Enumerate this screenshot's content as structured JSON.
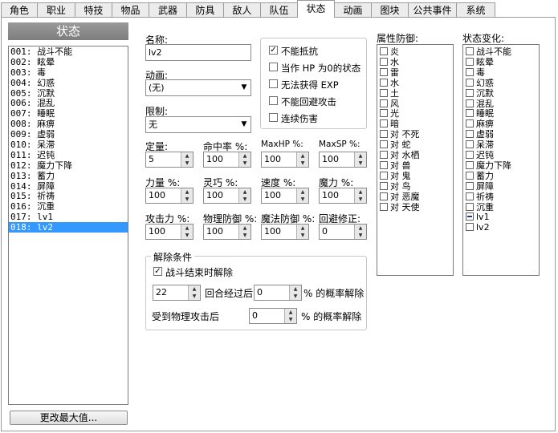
{
  "tabs": [
    "角色",
    "职业",
    "特技",
    "物品",
    "武器",
    "防具",
    "敌人",
    "队伍",
    "状态",
    "动画",
    "图块",
    "公共事件",
    "系统"
  ],
  "active_tab": "状态",
  "list_title": "状态",
  "states": [
    "001: 战斗不能",
    "002: 眩晕",
    "003: 毒",
    "004: 幻惑",
    "005: 沉默",
    "006: 混乱",
    "007: 睡眠",
    "008: 麻痹",
    "009: 虚弱",
    "010: 呆滞",
    "011: 迟钝",
    "012: 魔力下降",
    "013: 蓄力",
    "014: 屏障",
    "015: 祈祷",
    "016: 沉重",
    "017: lv1",
    "018: lv2"
  ],
  "selected_index": 17,
  "change_max_button": "更改最大值...",
  "form": {
    "name_label": "名称:",
    "name_value": "lv2",
    "animation_label": "动画:",
    "animation_value": "(无)",
    "restriction_label": "限制:",
    "restriction_value": "无",
    "fields": [
      {
        "label": "定量:",
        "value": "5"
      },
      {
        "label": "命中率 %:",
        "value": "100"
      },
      {
        "label": "MaxHP %:",
        "value": "100"
      },
      {
        "label": "MaxSP %:",
        "value": "100"
      },
      {
        "label": "力量 %:",
        "value": "100"
      },
      {
        "label": "灵巧 %:",
        "value": "100"
      },
      {
        "label": "速度 %:",
        "value": "100"
      },
      {
        "label": "魔力 %:",
        "value": "100"
      },
      {
        "label": "攻击力 %:",
        "value": "100"
      },
      {
        "label": "物理防御 %:",
        "value": "100"
      },
      {
        "label": "魔法防御 %:",
        "value": "100"
      },
      {
        "label": "回避修正:",
        "value": "0"
      }
    ],
    "options": [
      {
        "label": "不能抵抗",
        "checked": true
      },
      {
        "label": "当作 HP 为0的状态",
        "checked": false
      },
      {
        "label": "无法获得 EXP",
        "checked": false
      },
      {
        "label": "不能回避攻击",
        "checked": false
      },
      {
        "label": "连续伤害",
        "checked": false
      }
    ],
    "release": {
      "title": "解除条件",
      "battle_end_label": "战斗结束时解除",
      "battle_end_checked": true,
      "turns_value": "22",
      "turns_text": "回合经过后",
      "turns_chance_value": "0",
      "turns_chance_text": "% 的概率解除",
      "phys_text": "受到物理攻击后",
      "phys_chance_value": "0",
      "phys_chance_text": "% 的概率解除"
    }
  },
  "guard": {
    "label": "属性防御:",
    "items": [
      "炎",
      "水",
      "雷",
      "水",
      "土",
      "风",
      "光",
      "暗",
      "对 不死",
      "对 蛇",
      "对 水栖",
      "对 兽",
      "对 鬼",
      "对 鸟",
      "对 恶魔",
      "对 天使"
    ]
  },
  "state_change": {
    "label": "状态变化:",
    "items": [
      "战斗不能",
      "眩晕",
      "毒",
      "幻惑",
      "沉默",
      "混乱",
      "睡眠",
      "麻痹",
      "虚弱",
      "呆滞",
      "迟钝",
      "魔力下降",
      "蓄力",
      "屏障",
      "祈祷",
      "沉重",
      "lv1",
      "lv2"
    ],
    "minus_index": 16
  },
  "icons": {
    "dropdown": "chevron-down-icon",
    "spin_up": "spin-up-icon",
    "spin_down": "spin-down-icon",
    "check": "check-icon"
  }
}
